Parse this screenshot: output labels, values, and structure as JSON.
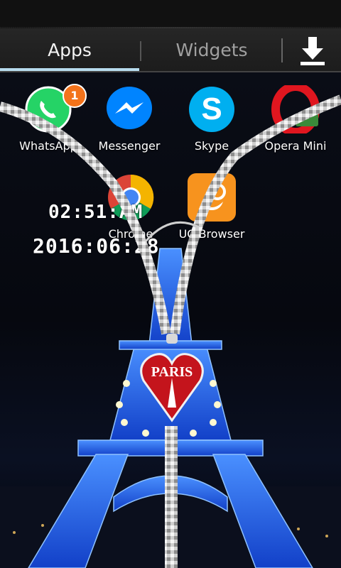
{
  "tabs": {
    "apps_label": "Apps",
    "widgets_label": "Widgets",
    "download_icon": "download-icon"
  },
  "apps": [
    {
      "label": "WhatsApp",
      "icon": "whatsapp-icon",
      "badge": "1",
      "color": "#25d366"
    },
    {
      "label": "Messenger",
      "icon": "messenger-icon",
      "color": "#0084ff"
    },
    {
      "label": "Skype",
      "icon": "skype-icon",
      "color": "#00aff0"
    },
    {
      "label": "Opera Mini",
      "icon": "opera-icon",
      "color": "#e0161f"
    },
    {
      "label": "Chrome",
      "icon": "chrome-icon",
      "color": "#4285f4"
    },
    {
      "label": "UC Browser",
      "icon": "uc-browser-icon",
      "color": "#f7931e"
    }
  ],
  "lock_clock": {
    "time": "02:51:AM",
    "date": "2016:06:28"
  },
  "zipper": {
    "heart_text": "PARIS",
    "heart_color": "#c4141c"
  },
  "accent_colors": {
    "tab_underline": "#b8dcee",
    "tower_light": "#1e6bff"
  }
}
